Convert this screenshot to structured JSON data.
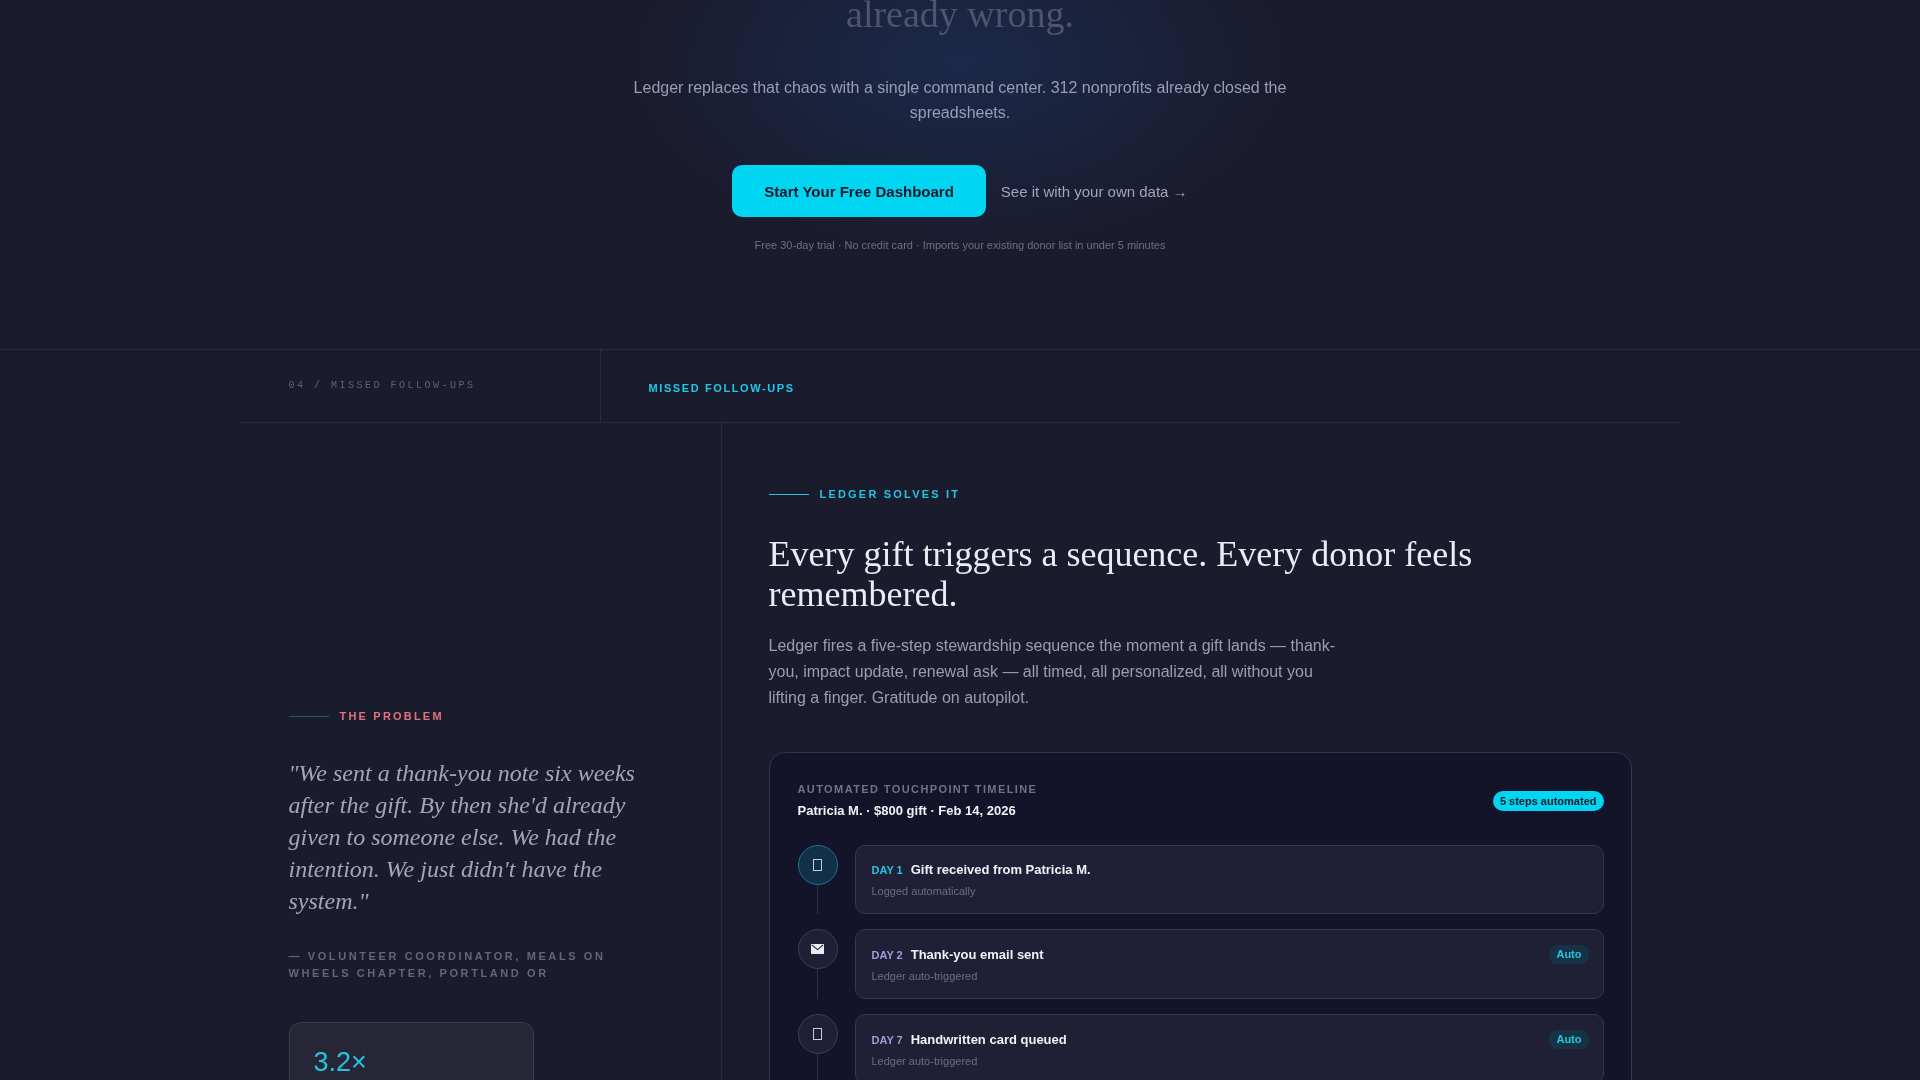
{
  "hero": {
    "heading_tail": "already wrong.",
    "subtitle": "Ledger replaces that chaos with a single command center. 312 nonprofits already closed the spreadsheets.",
    "primary_button": "Start Your Free Dashboard",
    "secondary_link": "See it with your own data →",
    "fine_print": "Free 30-day trial · No credit card · Imports your existing donor list in under 5 minutes"
  },
  "section_bar": {
    "index_label": "04 / MISSED FOLLOW-UPS",
    "title": "MISSED FOLLOW-UPS"
  },
  "problem": {
    "eyebrow": "THE PROBLEM",
    "quote": "\"We sent a thank-you note six weeks after the gift. By then she'd already given to someone else. We had the intention. We just didn't have the system.\"",
    "attribution": "— VOLUNTEER COORDINATOR, MEALS ON WHEELS CHAPTER, PORTLAND OR",
    "stat": "3.2×"
  },
  "solution": {
    "eyebrow": "LEDGER SOLVES IT",
    "heading": "Every gift triggers a sequence. Every donor feels remembered.",
    "body": "Ledger fires a five-step stewardship sequence the moment a gift lands — thank-you, impact update, renewal ask — all timed, all personalized, all without you lifting a finger. Gratitude on autopilot.",
    "timeline": {
      "title": "AUTOMATED TOUCHPOINT TIMELINE",
      "summary": "Patricia M. · $800 gift · Feb 14, 2026",
      "badge": "5 steps automated",
      "steps": [
        {
          "kind": "gift",
          "day": "DAY 1",
          "title": "Gift received from Patricia M.",
          "note": "Logged automatically",
          "current": true
        },
        {
          "kind": "email",
          "day": "DAY 2",
          "title": "Thank-you email sent",
          "note": "Ledger auto-triggered",
          "badge": "Auto",
          "current": false
        },
        {
          "kind": "card",
          "day": "DAY 7",
          "title": "Handwritten card queued",
          "note": "Ledger auto-triggered",
          "badge": "Auto",
          "current": false
        }
      ]
    }
  }
}
